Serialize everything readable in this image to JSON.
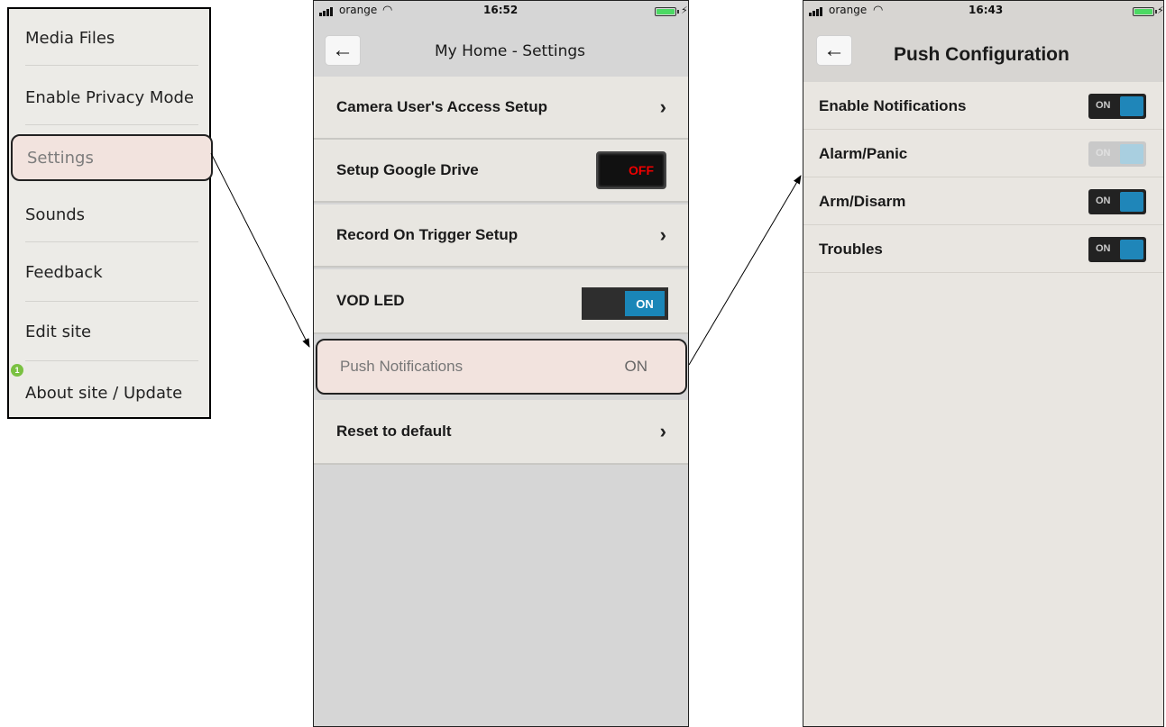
{
  "menu": {
    "items": [
      {
        "label": "Media Files"
      },
      {
        "label": "Enable Privacy Mode"
      },
      {
        "label": "Settings",
        "highlighted": true
      },
      {
        "label": "Sounds"
      },
      {
        "label": "Feedback"
      },
      {
        "label": "Edit site"
      },
      {
        "label": "About site / Update",
        "badge": "1"
      }
    ]
  },
  "settings_screen": {
    "status": {
      "carrier": "orange",
      "time": "16:52"
    },
    "title": "My Home - Settings",
    "rows": [
      {
        "label": "Camera User's Access Setup",
        "control": "chevron-right-icon"
      },
      {
        "label": "Setup Google Drive",
        "control": "toggle",
        "value": "OFF"
      },
      {
        "label": "Record On Trigger Setup",
        "control": "chevron-right-icon"
      },
      {
        "label": "VOD LED",
        "control": "toggle",
        "value": "ON"
      },
      {
        "label": "Push Notifications",
        "value": "ON",
        "highlighted": true
      },
      {
        "label": "Reset to default",
        "control": "chevron-right-icon"
      }
    ]
  },
  "push_screen": {
    "status": {
      "carrier": "orange",
      "time": "16:43"
    },
    "title": "Push Configuration",
    "rows": [
      {
        "label": "Enable Notifications",
        "value": "ON"
      },
      {
        "label": "Alarm/Panic",
        "value": "ON",
        "disabled": true
      },
      {
        "label": "Arm/Disarm",
        "value": "ON"
      },
      {
        "label": "Troubles",
        "value": "ON"
      }
    ]
  },
  "colors": {
    "highlight": "#f2e3de",
    "toggle_blue": "#1a86b8",
    "off_red": "#e00000",
    "badge_green": "#7ac142"
  }
}
